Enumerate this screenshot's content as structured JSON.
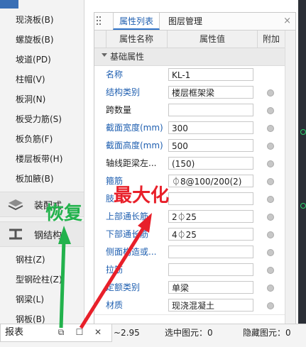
{
  "sidebar": {
    "items_top": [
      "现浇板(B)",
      "螺旋板(B)",
      "坡道(PD)",
      "柱帽(V)",
      "板洞(N)",
      "板受力筋(S)",
      "板负筋(F)",
      "楼层板带(H)",
      "板加腋(B)"
    ],
    "groups": [
      "装配式",
      "钢结构"
    ],
    "items_bottom": [
      "钢柱(Z)",
      "型钢砼柱(Z)",
      "钢梁(L)",
      "钢板(B)"
    ]
  },
  "panel": {
    "tabs": [
      "属性列表",
      "图层管理"
    ],
    "close_icon": "close-icon",
    "columns": [
      "属性名称",
      "属性值",
      "附加"
    ],
    "group_label": "基础属性",
    "rows": [
      {
        "name": "名称",
        "value": "KL-1",
        "blue": true,
        "check": false
      },
      {
        "name": "结构类别",
        "value": "楼层框架梁",
        "blue": true,
        "check": true
      },
      {
        "name": "跨数量",
        "value": "",
        "blue": false,
        "check": true
      },
      {
        "name": "截面宽度(mm)",
        "value": "300",
        "blue": true,
        "check": true
      },
      {
        "name": "截面高度(mm)",
        "value": "500",
        "blue": true,
        "check": true
      },
      {
        "name": "轴线距梁左...",
        "value": "(150)",
        "blue": false,
        "check": true
      },
      {
        "name": "箍筋",
        "value": "⏀8@100/200(2)",
        "blue": true,
        "check": true
      },
      {
        "name": "肢",
        "value": "",
        "blue": true,
        "check": true
      },
      {
        "name": "上部通长筋",
        "value": "2⏀25",
        "blue": true,
        "check": true
      },
      {
        "name": "下部通长筋",
        "value": "4⏀25",
        "blue": true,
        "check": true
      },
      {
        "name": "侧面构造或...",
        "value": "",
        "blue": true,
        "check": true
      },
      {
        "name": "拉筋",
        "value": "",
        "blue": true,
        "check": true
      },
      {
        "name": "定额类别",
        "value": "单梁",
        "blue": true,
        "check": true
      },
      {
        "name": "材质",
        "value": "现浇混凝土",
        "blue": true,
        "check": true
      }
    ]
  },
  "statusbar": {
    "report_label": "报表",
    "coord_fragment": "~2.95",
    "selected": "选中图元：0",
    "hidden": "隐藏图元：0"
  },
  "annotations": {
    "restore": "恢复",
    "maximize": "最大化",
    "green": "#22b24c",
    "red": "#e8202a"
  }
}
